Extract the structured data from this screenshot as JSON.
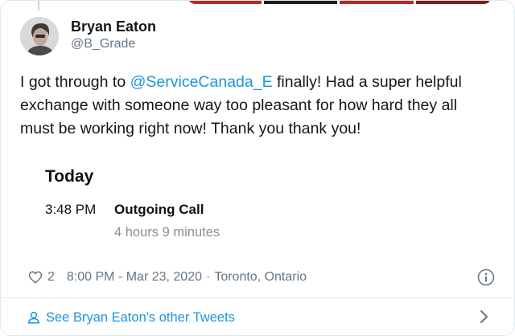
{
  "tweet": {
    "author_name": "Bryan Eaton",
    "author_handle": "@B_Grade",
    "text_before": "I got through to ",
    "mention": "@ServiceCanada_E",
    "text_after": " finally! Had a super helpful exchange with someone way too pleasant for how hard they all must be working right now! Thank you thank you!",
    "embedded_call": {
      "title": "Today",
      "time": "3:48 PM",
      "type": "Outgoing Call",
      "duration": "4 hours 9 minutes"
    },
    "likes": "2",
    "timestamp": "8:00 PM - Mar 23, 2020",
    "separator": "·",
    "location": "Toronto, Ontario",
    "more_tweets_label": "See Bryan Eaton's other Tweets"
  },
  "icons": {
    "like": "heart-icon",
    "info": "info-icon",
    "profile": "person-icon",
    "next": "chevron-right-icon"
  },
  "colors": {
    "link": "#1b95e0",
    "secondary_text": "#657786",
    "border": "#e1e8ed"
  }
}
